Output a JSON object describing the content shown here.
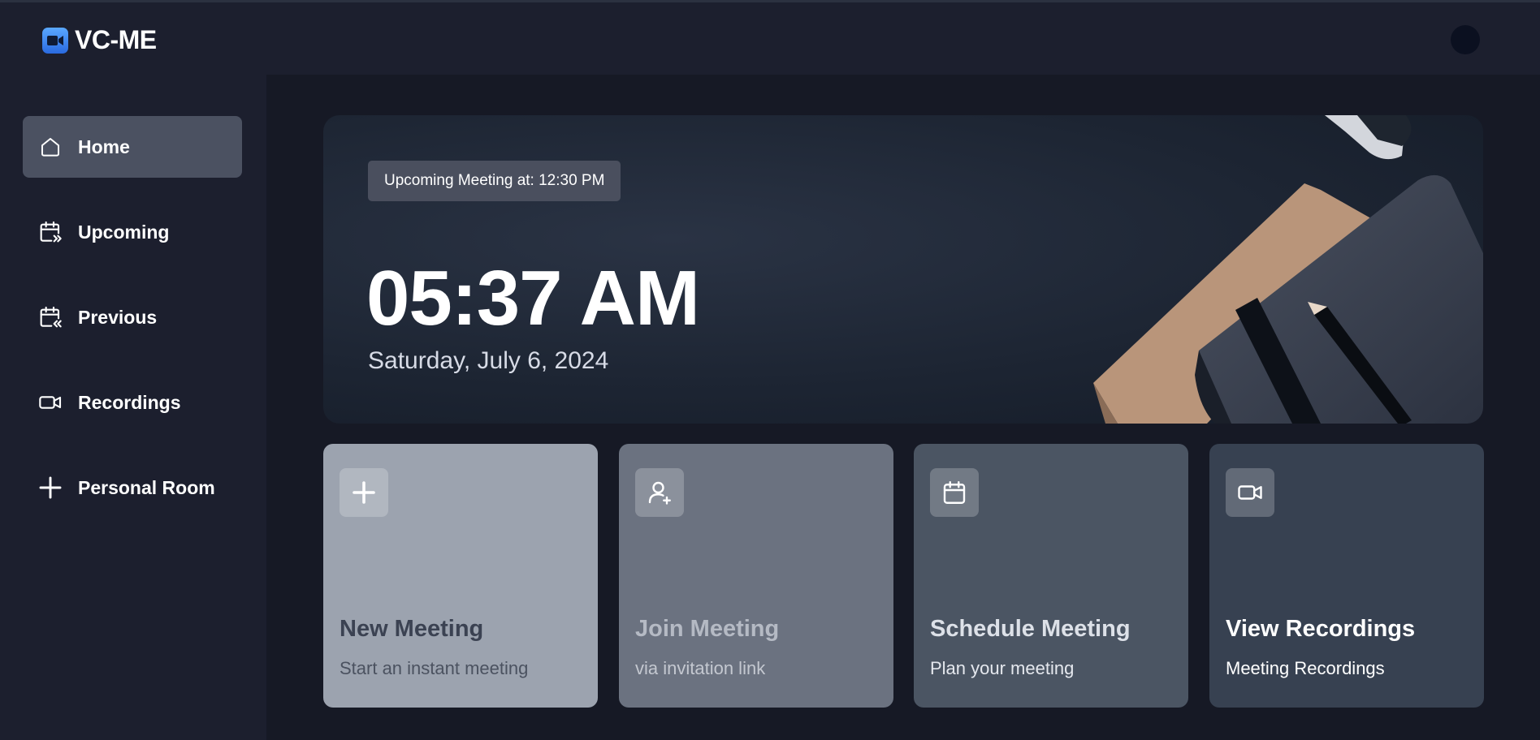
{
  "app": {
    "name": "VC-ME"
  },
  "sidebar": {
    "items": [
      {
        "label": "Home",
        "icon": "home-icon",
        "active": true
      },
      {
        "label": "Upcoming",
        "icon": "calendar-upcoming-icon"
      },
      {
        "label": "Previous",
        "icon": "calendar-previous-icon"
      },
      {
        "label": "Recordings",
        "icon": "video-icon"
      },
      {
        "label": "Personal Room",
        "icon": "plus-icon"
      }
    ]
  },
  "hero": {
    "badge": "Upcoming Meeting at: 12:30 PM",
    "time": "05:37 AM",
    "date": "Saturday, July 6, 2024"
  },
  "cards": [
    {
      "title": "New Meeting",
      "subtitle": "Start an instant meeting",
      "icon": "plus-icon",
      "bg": "#9ca3af"
    },
    {
      "title": "Join Meeting",
      "subtitle": "via invitation link",
      "icon": "user-plus-icon",
      "bg": "#6b7280"
    },
    {
      "title": "Schedule Meeting",
      "subtitle": "Plan your meeting",
      "icon": "calendar-icon",
      "bg": "#4b5563"
    },
    {
      "title": "View Recordings",
      "subtitle": "Meeting Recordings",
      "icon": "video-icon",
      "bg": "#374151"
    }
  ],
  "colors": {
    "background": "#161925",
    "panel": "#1c1f2e",
    "active_item": "#4b5161",
    "brand": "#2d8cff"
  }
}
